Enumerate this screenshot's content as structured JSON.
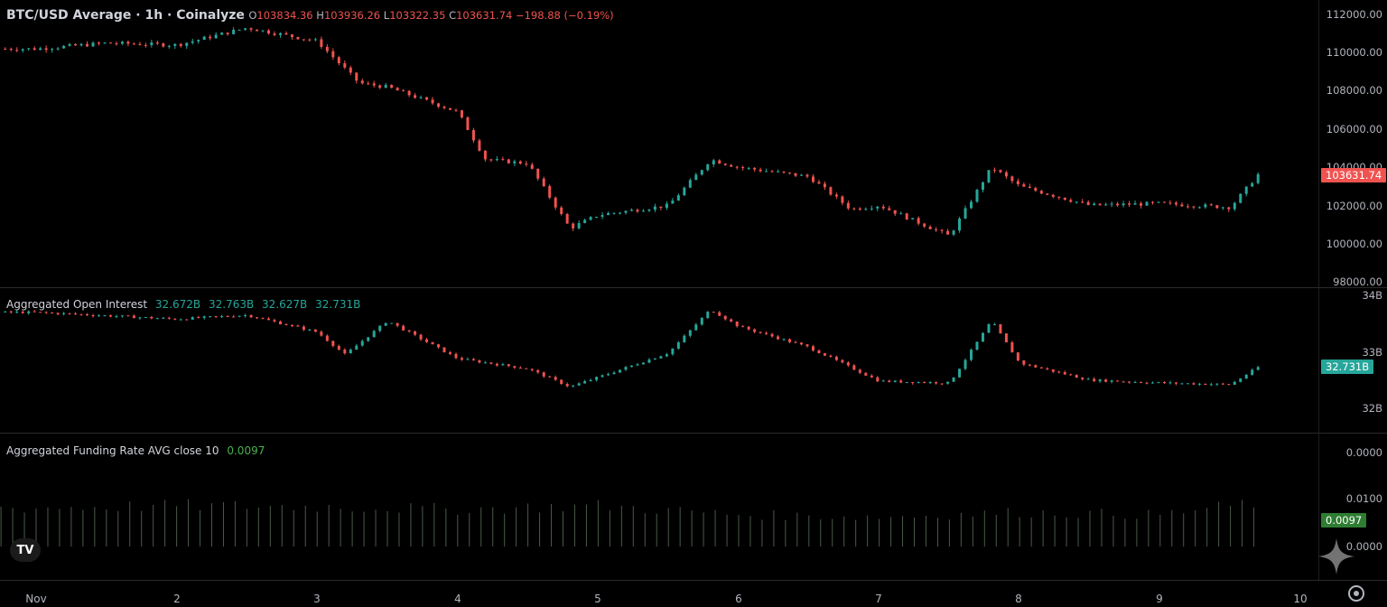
{
  "header": {
    "title": "BTC/USD Average · 1h · Coinalyze",
    "o_label": "O",
    "o_value": "103834.36",
    "h_label": "H",
    "h_value": "103936.26",
    "l_label": "L",
    "l_value": "103322.35",
    "c_label": "C",
    "c_value": "103631.74",
    "change": "−198.88 (−0.19%)"
  },
  "price_axis": {
    "ticks": [
      "112000.00",
      "110000.00",
      "108000.00",
      "106000.00",
      "104000.00",
      "102000.00",
      "100000.00",
      "98000.00"
    ],
    "last_tag": "103631.74"
  },
  "oi": {
    "title": "Aggregated Open Interest",
    "o": "32.672B",
    "h": "32.763B",
    "l": "32.627B",
    "c": "32.731B",
    "ticks": [
      "34B",
      "33B",
      "32B"
    ],
    "last_tag": "32.731B"
  },
  "funding": {
    "title": "Aggregated Funding Rate AVG close 10",
    "value": "0.0097",
    "ticks": [
      "0.0000",
      "0.0100",
      "0.0000"
    ],
    "last_tag": "0.0097"
  },
  "time_axis": [
    "Nov",
    "2",
    "3",
    "4",
    "5",
    "6",
    "7",
    "8",
    "9",
    "10"
  ],
  "logo_text": "TV",
  "colors": {
    "up": "#26a69a",
    "down": "#ef5350",
    "bg": "#000000"
  },
  "chart_data": [
    {
      "type": "line",
      "title": "BTC/USD Average · 1h · Coinalyze",
      "x": [
        "Nov 1",
        "Nov 1.5",
        "Nov 2",
        "Nov 2.5",
        "Nov 3",
        "Nov 3.3",
        "Nov 3.5",
        "Nov 4",
        "Nov 4.2",
        "Nov 4.5",
        "Nov 4.8",
        "Nov 5",
        "Nov 5.5",
        "Nov 5.8",
        "Nov 6",
        "Nov 6.5",
        "Nov 6.8",
        "Nov 7",
        "Nov 7.5",
        "Nov 7.8",
        "Nov 8",
        "Nov 8.5",
        "Nov 9",
        "Nov 9.5",
        "Nov 9.7"
      ],
      "series": [
        {
          "values": [
            110200,
            110500,
            110400,
            111300,
            110600,
            108400,
            108200,
            106900,
            104400,
            104200,
            100800,
            101500,
            102000,
            104400,
            104000,
            103500,
            101800,
            102000,
            100400,
            104000,
            103000,
            102000,
            102100,
            101900,
            103650
          ]
        }
      ],
      "ylim": [
        98000,
        112000
      ]
    },
    {
      "type": "line",
      "title": "Aggregated Open Interest",
      "x": [
        "Nov 1",
        "Nov 2",
        "Nov 2.5",
        "Nov 3",
        "Nov 3.2",
        "Nov 3.5",
        "Nov 4",
        "Nov 4.5",
        "Nov 4.8",
        "Nov 5",
        "Nov 5.5",
        "Nov 5.8",
        "Nov 6",
        "Nov 6.5",
        "Nov 7",
        "Nov 7.5",
        "Nov 7.8",
        "Nov 8",
        "Nov 8.5",
        "Nov 9",
        "Nov 9.5",
        "Nov 9.7"
      ],
      "series": [
        {
          "values": [
            33.7,
            33.58,
            33.65,
            33.35,
            32.95,
            33.55,
            32.88,
            32.7,
            32.38,
            32.55,
            32.98,
            33.75,
            33.45,
            33.08,
            32.48,
            32.45,
            33.55,
            32.8,
            32.5,
            32.45,
            32.42,
            32.731
          ]
        }
      ],
      "ylim": [
        32,
        34
      ]
    },
    {
      "type": "bar",
      "title": "Aggregated Funding Rate AVG close 10",
      "x": [
        "Nov 1",
        "Nov 2",
        "Nov 3",
        "Nov 4",
        "Nov 5",
        "Nov 6",
        "Nov 7",
        "Nov 8",
        "Nov 9",
        "Nov 9.7"
      ],
      "values": [
        0.0085,
        0.009,
        0.0088,
        0.0082,
        0.009,
        0.007,
        0.0065,
        0.0075,
        0.007,
        0.0097
      ]
    }
  ]
}
